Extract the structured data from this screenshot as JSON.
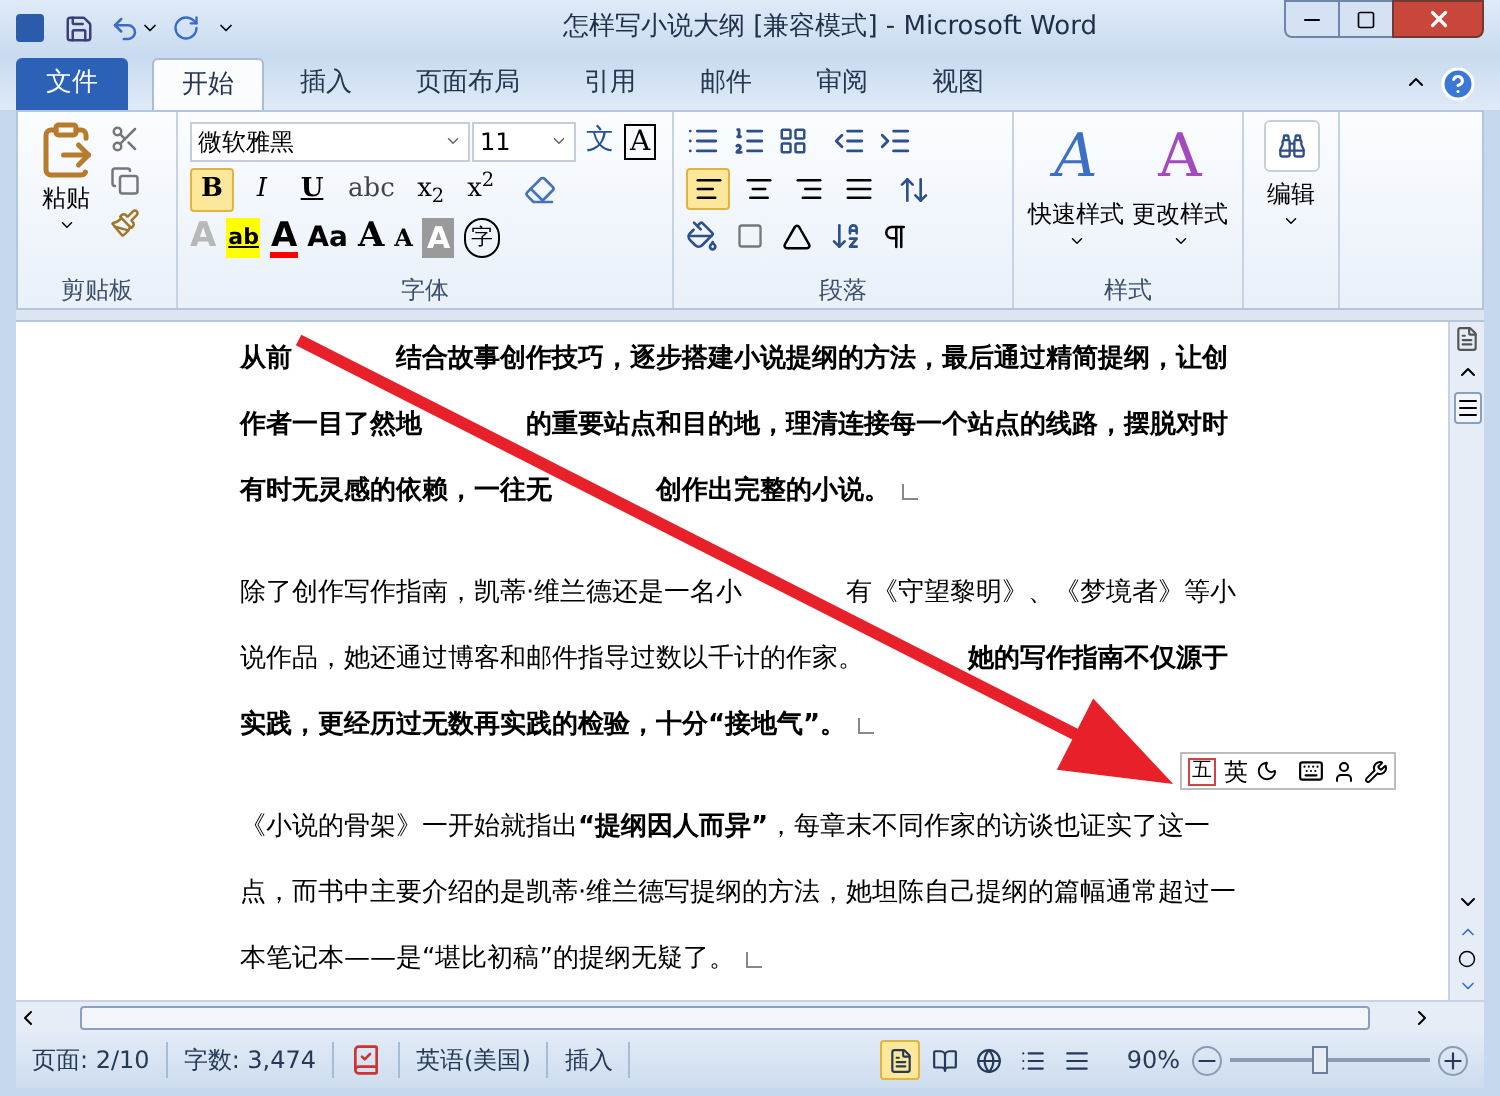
{
  "window": {
    "title": "怎样写小说大纲 [兼容模式] - Microsoft Word"
  },
  "tabs": [
    {
      "label": "文件",
      "kind": "file",
      "selected": false
    },
    {
      "label": "开始",
      "kind": "tab",
      "selected": true
    },
    {
      "label": "插入",
      "kind": "tab",
      "selected": false
    },
    {
      "label": "页面布局",
      "kind": "tab",
      "selected": false
    },
    {
      "label": "引用",
      "kind": "tab",
      "selected": false
    },
    {
      "label": "邮件",
      "kind": "tab",
      "selected": false
    },
    {
      "label": "审阅",
      "kind": "tab",
      "selected": false
    },
    {
      "label": "视图",
      "kind": "tab",
      "selected": false
    }
  ],
  "clipboard": {
    "paste_label": "粘贴",
    "group_label": "剪贴板"
  },
  "font": {
    "font_name": "微软雅黑",
    "font_size": "11",
    "group_label": "字体",
    "top_tools": [
      {
        "glyph": "文",
        "kind": "phonetic"
      },
      {
        "glyph": "A",
        "kind": "border"
      }
    ],
    "format_buttons": [
      {
        "glyph": "B",
        "kind": "bold",
        "selected": true
      },
      {
        "glyph": "I",
        "kind": "italic",
        "selected": false
      },
      {
        "glyph": "U",
        "kind": "underline",
        "selected": false
      },
      {
        "glyph": "abc",
        "kind": "strike",
        "selected": false
      },
      {
        "glyph": "x$_{2}$",
        "kind": "sub",
        "selected": false
      },
      {
        "glyph": "x$^{2}$",
        "kind": "sup",
        "selected": false
      }
    ],
    "tools": [
      {
        "glyph": "A",
        "kind": "effects"
      },
      {
        "glyph": "ab",
        "kind": "highlight"
      },
      {
        "glyph": "A",
        "kind": "color"
      },
      {
        "glyph": "Aa",
        "kind": "case"
      },
      {
        "glyph": "A",
        "kind": "grow"
      },
      {
        "glyph": "A",
        "kind": "shrink"
      },
      {
        "glyph": "A",
        "kind": "shade"
      },
      {
        "glyph": "字",
        "kind": "enclose"
      }
    ]
  },
  "paragraph": {
    "group_label": "段落",
    "alignments": [
      {
        "kind": "left",
        "selected": true
      },
      {
        "kind": "center",
        "selected": false
      },
      {
        "kind": "right",
        "selected": false
      },
      {
        "kind": "justify",
        "selected": false
      }
    ]
  },
  "styles": {
    "group_label": "样式",
    "buttons": [
      {
        "glyph": "A",
        "label": "快速样式",
        "kind": "quick"
      },
      {
        "glyph": "A",
        "label": "更改样式",
        "kind": "change"
      }
    ]
  },
  "editing": {
    "label": "编辑"
  },
  "document": {
    "paragraphs": [
      {
        "lines": [
          {
            "segments": [
              {
                "kind": "text",
                "text": "从前",
                "bold": true
              },
              {
                "kind": "covered"
              },
              {
                "kind": "text",
                "text": "结合故事创作技巧，逐步搭建小说提纲的方法，最后通过精简提纲，让创",
                "bold": true
              }
            ]
          },
          {
            "segments": [
              {
                "kind": "text",
                "text": "作者一目了然地",
                "bold": true
              },
              {
                "kind": "covered"
              },
              {
                "kind": "text",
                "text": "的重要站点和目的地，理清连接每一个站点的线路，摆脱对时",
                "bold": true
              }
            ]
          },
          {
            "segments": [
              {
                "kind": "text",
                "text": "有时无灵感的依赖，一往无",
                "bold": true
              },
              {
                "kind": "covered"
              },
              {
                "kind": "text",
                "text": "创作出完整的小说。",
                "bold": true
              }
            ]
          }
        ]
      },
      {
        "lines": [
          {
            "segments": [
              {
                "kind": "text",
                "text": "除了创作写作指南，凯蒂·维兰德还是一名小",
                "bold": false
              },
              {
                "kind": "covered"
              },
              {
                "kind": "text",
                "text": "有《守望黎明》、《梦境者》等小",
                "bold": false
              }
            ]
          },
          {
            "segments": [
              {
                "kind": "text",
                "text": "说作品，她还通过博客和邮件指导过数以千计的作家。",
                "bold": false
              },
              {
                "kind": "covered"
              },
              {
                "kind": "text",
                "text": "她的写作指南不仅源于",
                "bold": true
              }
            ]
          },
          {
            "segments": [
              {
                "kind": "text",
                "text": "实践，更经历过无数再实践的检验，十分“接地气”。",
                "bold": true
              }
            ]
          }
        ]
      },
      {
        "lines": [
          {
            "segments": [
              {
                "kind": "text",
                "text": "《小说的骨架》一开始就指出",
                "bold": false
              },
              {
                "kind": "text",
                "text": "“提纲因人而异”",
                "bold": true
              },
              {
                "kind": "text",
                "text": "，每章末不同作家的访谈也证实了这一",
                "bold": false
              }
            ]
          },
          {
            "segments": [
              {
                "kind": "text",
                "text": "点，而书中主要介绍的是凯蒂·维兰德写提纲的方法，她坦陈自己提纲的篇幅通常超过一",
                "bold": false
              }
            ]
          },
          {
            "segments": [
              {
                "kind": "text",
                "text": "本笔记本——是“堪比初稿”的提纲无疑了。",
                "bold": false
              }
            ]
          }
        ]
      }
    ]
  },
  "ime_toolbar": {
    "badge": "五",
    "mode": "英"
  },
  "status_bar": {
    "page": "页面: 2/10",
    "words": "字数: 3,474",
    "language": "英语(美国)",
    "mode": "插入",
    "zoom": "90%",
    "level": 0.45,
    "views": [
      {
        "selected": true
      },
      {
        "selected": false
      },
      {
        "selected": false
      },
      {
        "selected": false
      },
      {
        "selected": false
      }
    ]
  }
}
